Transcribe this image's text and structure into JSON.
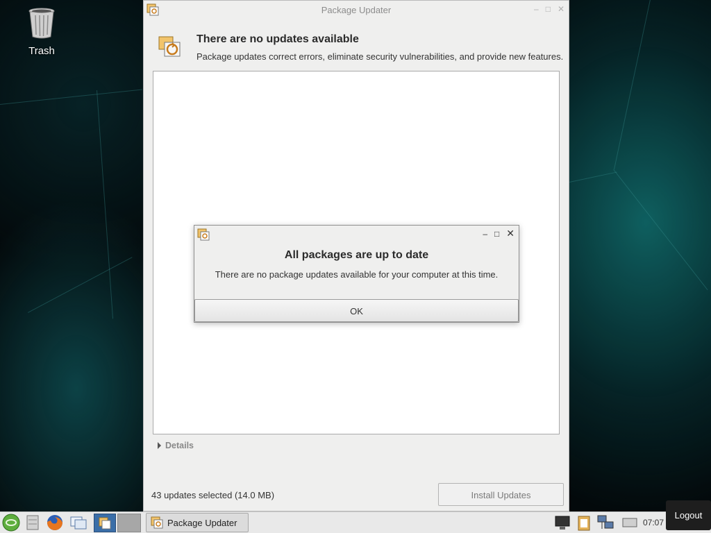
{
  "desktop": {
    "trash_label": "Trash"
  },
  "window": {
    "title": "Package Updater",
    "header_title": "There are no updates available",
    "header_subtitle": "Package updates correct errors, eliminate security vulnerabilities, and provide new features.",
    "details_label": "Details",
    "status_text": "43 updates selected (14.0 MB)",
    "install_button_label": "Install Updates"
  },
  "dialog": {
    "heading": "All packages are up to date",
    "message": "There are no package updates available for your computer at this time.",
    "ok_label": "OK"
  },
  "taskbar": {
    "task_button_label": "Package Updater",
    "clock": "07:07",
    "logout_tooltip": "Logout"
  }
}
